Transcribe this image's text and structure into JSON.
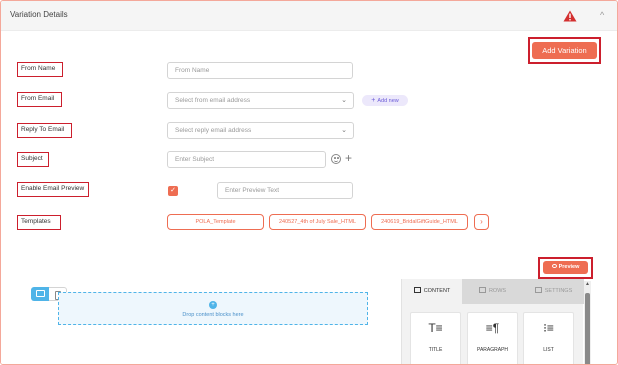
{
  "header": {
    "title": "Variation Details"
  },
  "buttons": {
    "add_variation": "Add Variation",
    "preview": "Preview"
  },
  "labels": {
    "from_name": "From Name",
    "from_email": "From Email",
    "reply_to_email": "Reply To Email",
    "subject": "Subject",
    "enable_email_preview": "Enable Email Preview",
    "templates": "Templates"
  },
  "fields": {
    "from_name_placeholder": "From Name",
    "from_email_placeholder": "Select from email address",
    "reply_to_placeholder": "Select reply email address",
    "subject_placeholder": "Enter Subject",
    "preview_text_placeholder": "Enter Preview Text"
  },
  "add_new": "Add new",
  "enable_preview_checked": true,
  "templates": [
    "POLA_Template",
    "240527_4th of July Sale_HTML",
    "240619_BridalGiftGuide_HTML"
  ],
  "editor": {
    "drop_text": "Drop content blocks here",
    "tabs": [
      "CONTENT",
      "ROWS",
      "SETTINGS"
    ],
    "active_tab": "CONTENT",
    "blocks": [
      "TITLE",
      "PARAGRAPH",
      "LIST"
    ]
  },
  "colors": {
    "accent": "#ee6d52",
    "highlight_border": "#cc1f2d",
    "editor_blue": "#4fb4e8",
    "warning": "#d32f2f"
  },
  "icons": {
    "warning": "warning-triangle-icon",
    "collapse": "chevron-up-icon",
    "emoji": "emoji-icon",
    "plus": "plus-icon",
    "preview": "eye-icon",
    "desktop": "desktop-icon",
    "mobile": "mobile-icon"
  }
}
